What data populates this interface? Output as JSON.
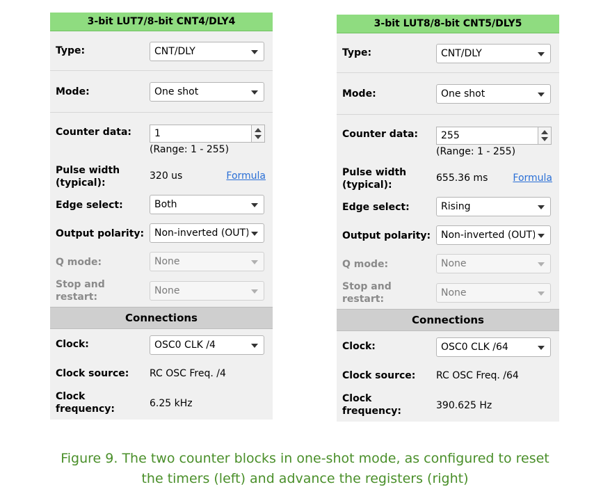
{
  "panels": [
    {
      "title": "3-bit LUT7/8-bit CNT4/DLY4",
      "type_label": "Type:",
      "type_value": "CNT/DLY",
      "mode_label": "Mode:",
      "mode_value": "One shot",
      "counter_label": "Counter data:",
      "counter_value": "1",
      "range_text": "(Range:  1 - 255)",
      "pulse_label_1": "Pulse width",
      "pulse_label_2": "(typical):",
      "pulse_value": "320 us",
      "formula_link": "Formula",
      "edge_label": "Edge select:",
      "edge_value": "Both",
      "polarity_label": "Output polarity:",
      "polarity_value": "Non-inverted (OUT)",
      "qmode_label": "Q mode:",
      "qmode_value": "None",
      "stop_label_1": "Stop and",
      "stop_label_2": "restart:",
      "stop_value": "None",
      "connections_title": "Connections",
      "clock_label": "Clock:",
      "clock_value": "OSC0 CLK /4",
      "clock_source_label": "Clock source:",
      "clock_source_value": "RC OSC Freq. /4",
      "clock_freq_label_1": "Clock",
      "clock_freq_label_2": "frequency:",
      "clock_freq_value": "6.25 kHz"
    },
    {
      "title": "3-bit LUT8/8-bit CNT5/DLY5",
      "type_label": "Type:",
      "type_value": "CNT/DLY",
      "mode_label": "Mode:",
      "mode_value": "One shot",
      "counter_label": "Counter data:",
      "counter_value": "255",
      "range_text": "(Range:  1 - 255)",
      "pulse_label_1": "Pulse width",
      "pulse_label_2": "(typical):",
      "pulse_value": "655.36 ms",
      "formula_link": "Formula",
      "edge_label": "Edge select:",
      "edge_value": "Rising",
      "polarity_label": "Output polarity:",
      "polarity_value": "Non-inverted (OUT)",
      "qmode_label": "Q mode:",
      "qmode_value": "None",
      "stop_label_1": "Stop and",
      "stop_label_2": "restart:",
      "stop_value": "None",
      "connections_title": "Connections",
      "clock_label": "Clock:",
      "clock_value": "OSC0 CLK /64",
      "clock_source_label": "Clock source:",
      "clock_source_value": "RC OSC Freq. /64",
      "clock_freq_label_1": "Clock",
      "clock_freq_label_2": "frequency:",
      "clock_freq_value": "390.625 Hz"
    }
  ],
  "caption": {
    "line1": "Figure 9. The two counter blocks in one-shot mode, as configured to reset",
    "line2": "the timers (left) and advance the registers (right)"
  },
  "colors": {
    "header_green": "#8fdc80",
    "caption_green": "#4a8f2a",
    "link_blue": "#2a6fd6"
  },
  "icons": {
    "dropdown": "chevron-down-icon",
    "spinner_up": "spin-up-icon",
    "spinner_down": "spin-down-icon"
  }
}
